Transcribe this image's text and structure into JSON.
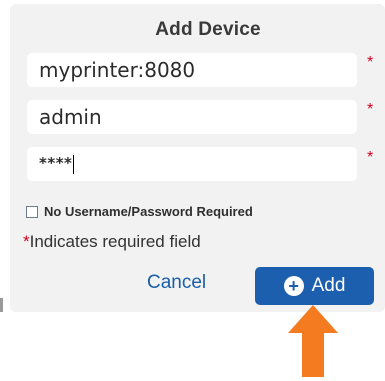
{
  "dialog": {
    "title": "Add Device"
  },
  "fields": {
    "host_value": "myprinter:8080",
    "username_value": "admin",
    "password_value": "****",
    "required_marker": "*"
  },
  "checkbox": {
    "label": "No Username/Password Required",
    "checked": false
  },
  "required_note": {
    "star": "*",
    "text": "Indicates required field"
  },
  "buttons": {
    "cancel_label": "Cancel",
    "add_label": "Add",
    "add_icon": "plus-circle-icon"
  },
  "colors": {
    "accent": "#1b5fae",
    "required": "#d0021b",
    "arrow": "#f47b20",
    "dialog_bg": "#f2f2f2"
  }
}
